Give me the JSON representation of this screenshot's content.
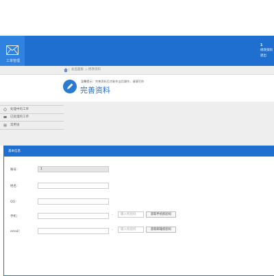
{
  "header": {
    "logo_caption": "工单管理",
    "user_number": "1",
    "menu_items": [
      "修改资料",
      "退出"
    ]
  },
  "breadcrumb": {
    "items": [
      "总监面板",
      "修改资料"
    ]
  },
  "page_header": {
    "hint": "温馨提示：完善资料后才能作业后操作，请填写你",
    "title": "完善资料"
  },
  "sidebar": {
    "items": [
      {
        "label": "处理中的工单",
        "icon": "refresh-icon"
      },
      {
        "label": "已处理的工单",
        "icon": "inbox-icon"
      },
      {
        "label": "常用语",
        "icon": "list-icon"
      }
    ]
  },
  "form": {
    "panel_title": "基本信息",
    "account_label": "账号：",
    "account_value": "1",
    "name_label": "姓名：",
    "name_value": "",
    "qq_label": "QQ：",
    "qq_value": "",
    "phone_label": "手机：",
    "phone_value": "",
    "phone_code_placeholder": "输入校验码",
    "phone_code_button": "获取手机校验码",
    "email_label": "email：",
    "email_value": "",
    "email_code_placeholder": "输入校验码",
    "email_code_button": "获取邮箱校验码"
  },
  "colors": {
    "primary": "#1e6fcf",
    "logo_tile": "#2f82df",
    "gray_bg": "#eeeeee"
  }
}
